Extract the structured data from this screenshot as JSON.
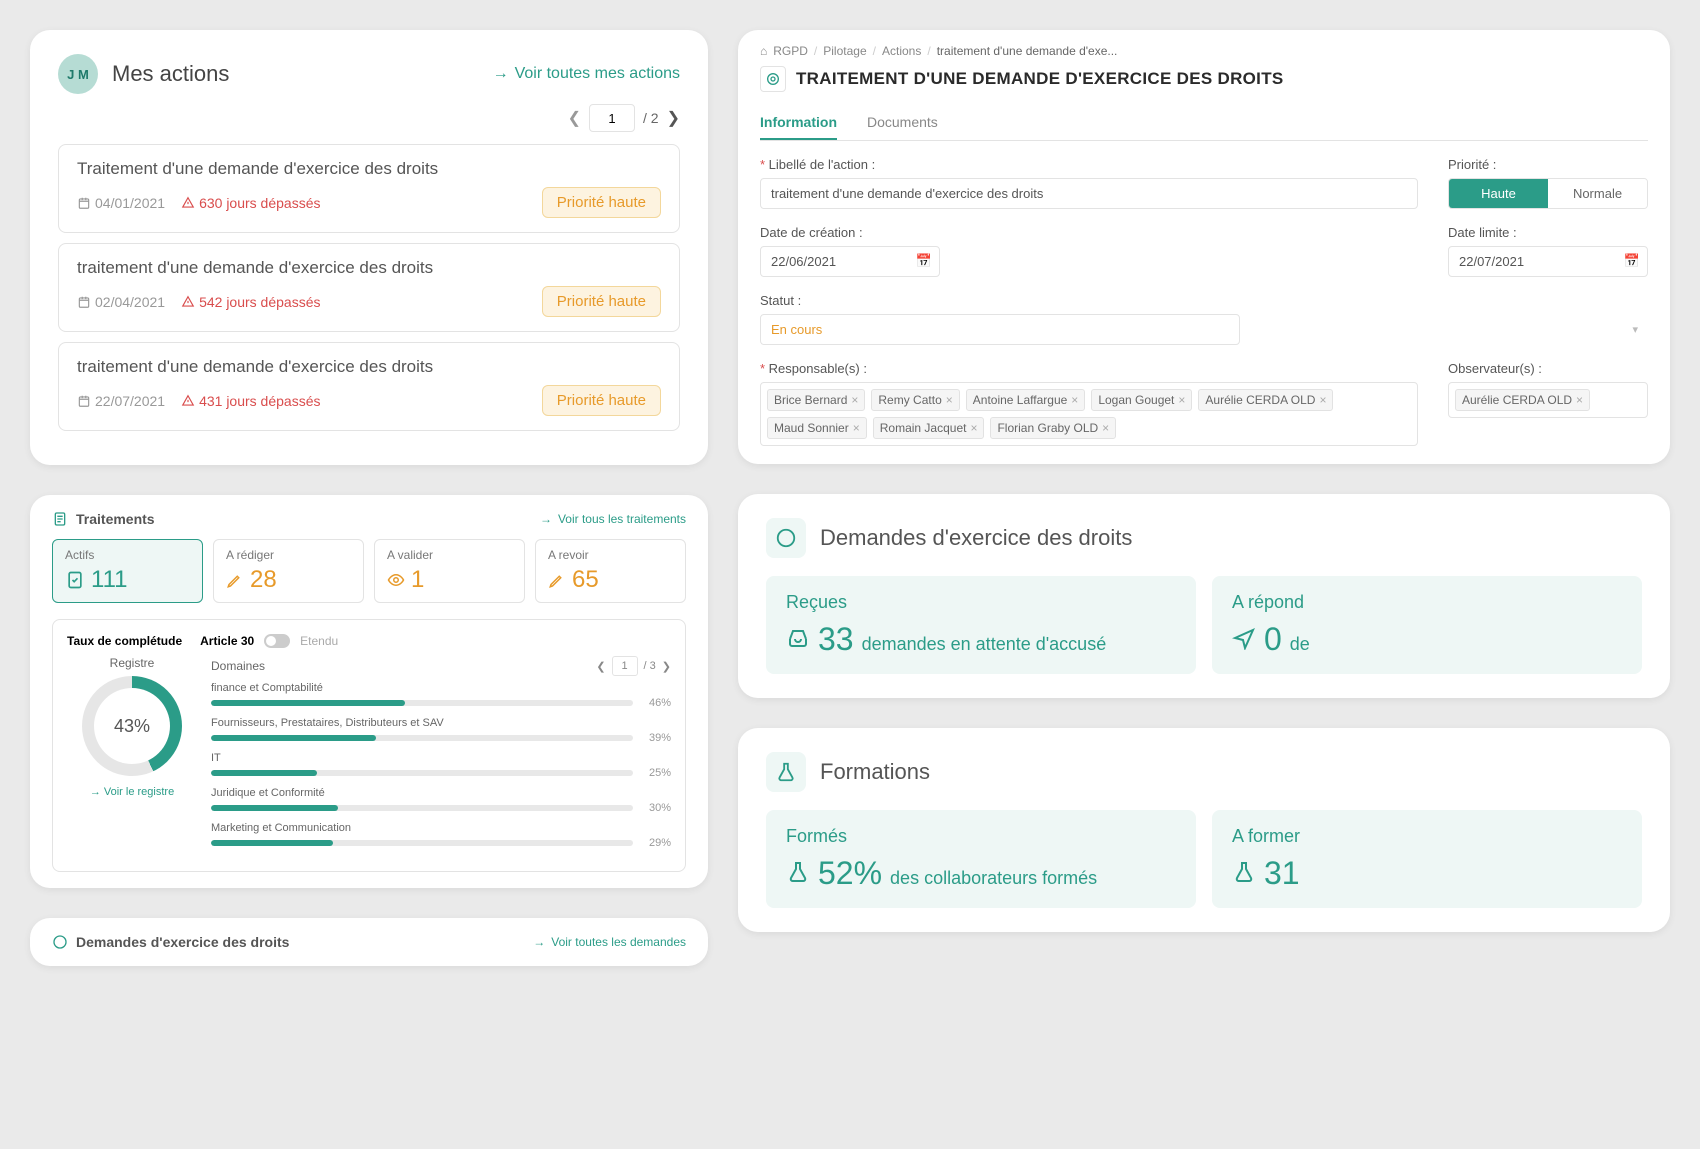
{
  "colors": {
    "teal": "#2b9c88"
  },
  "actions_panel": {
    "avatar_initials": "J M",
    "title": "Mes actions",
    "view_all": "Voir toutes mes actions",
    "page": "1",
    "total_pages": "2",
    "items": [
      {
        "title": "Traitement d'une demande d'exercice des droits",
        "date": "04/01/2021",
        "overdue": "630 jours dépassés",
        "priority": "Priorité haute"
      },
      {
        "title": "traitement d'une demande d'exercice des droits",
        "date": "02/04/2021",
        "overdue": "542 jours dépassés",
        "priority": "Priorité haute"
      },
      {
        "title": "traitement d'une demande d'exercice des droits",
        "date": "22/07/2021",
        "overdue": "431 jours dépassés",
        "priority": "Priorité haute"
      }
    ]
  },
  "traitements": {
    "header": "Traitements",
    "view_all": "Voir tous les traitements",
    "stats": [
      {
        "label": "Actifs",
        "value": "111",
        "style": "active"
      },
      {
        "label": "A rédiger",
        "value": "28",
        "style": "orange"
      },
      {
        "label": "A valider",
        "value": "1",
        "style": "orange"
      },
      {
        "label": "A revoir",
        "value": "65",
        "style": "orange"
      }
    ],
    "completude": {
      "title": "Taux de complétude",
      "mode_a": "Article 30",
      "mode_b": "Etendu",
      "registre_label": "Registre",
      "registre_pct": "43%",
      "voir": "Voir le registre"
    },
    "domaines": {
      "label": "Domaines",
      "page": "1",
      "total": "3",
      "rows": [
        {
          "name": "finance et Comptabilité",
          "pct": 46
        },
        {
          "name": "Fournisseurs, Prestataires, Distributeurs et SAV",
          "pct": 39
        },
        {
          "name": "IT",
          "pct": 25
        },
        {
          "name": "Juridique et Conformité",
          "pct": 30
        },
        {
          "name": "Marketing et Communication",
          "pct": 29
        }
      ]
    }
  },
  "demandes_mini": {
    "header": "Demandes d'exercice des droits",
    "view_all": "Voir toutes les demandes"
  },
  "detail": {
    "breadcrumb": [
      "RGPD",
      "Pilotage",
      "Actions",
      "traitement d'une demande d'exe..."
    ],
    "title": "TRAITEMENT D'UNE DEMANDE D'EXERCICE DES DROITS",
    "tabs": {
      "info": "Information",
      "docs": "Documents"
    },
    "fields": {
      "libelle_label": "Libellé de l'action :",
      "libelle_value": "traitement d'une demande d'exercice des droits",
      "priorite_label": "Priorité :",
      "prio_haute": "Haute",
      "prio_normale": "Normale",
      "date_creation_label": "Date de création :",
      "date_creation": "22/06/2021",
      "date_limite_label": "Date limite :",
      "date_limite": "22/07/2021",
      "statut_label": "Statut :",
      "statut_value": "En cours",
      "responsables_label": "Responsable(s) :",
      "observateurs_label": "Observateur(s) :",
      "responsables": [
        "Brice Bernard",
        "Remy Catto",
        "Antoine Laffargue",
        "Logan Gouget",
        "Aurélie CERDA OLD",
        "Maud Sonnier",
        "Romain Jacquet",
        "Florian Graby OLD"
      ],
      "observateurs": [
        "Aurélie CERDA OLD"
      ]
    }
  },
  "demandes": {
    "title": "Demandes d'exercice des droits",
    "cards": [
      {
        "label": "Reçues",
        "value": "33",
        "desc": "demandes en attente d'accusé"
      },
      {
        "label": "A répond",
        "value": "0",
        "desc": "de"
      }
    ]
  },
  "formations": {
    "title": "Formations",
    "cards": [
      {
        "label": "Formés",
        "value": "52%",
        "desc": "des collaborateurs formés"
      },
      {
        "label": "A former",
        "value": "31",
        "desc": ""
      }
    ]
  },
  "chart_data": {
    "type": "bar",
    "title": "Taux de complétude — Domaines",
    "categories": [
      "finance et Comptabilité",
      "Fournisseurs, Prestataires, Distributeurs et SAV",
      "IT",
      "Juridique et Conformité",
      "Marketing et Communication"
    ],
    "values": [
      46,
      39,
      25,
      30,
      29
    ],
    "xlabel": "",
    "ylabel": "%",
    "ylim": [
      0,
      100
    ]
  }
}
